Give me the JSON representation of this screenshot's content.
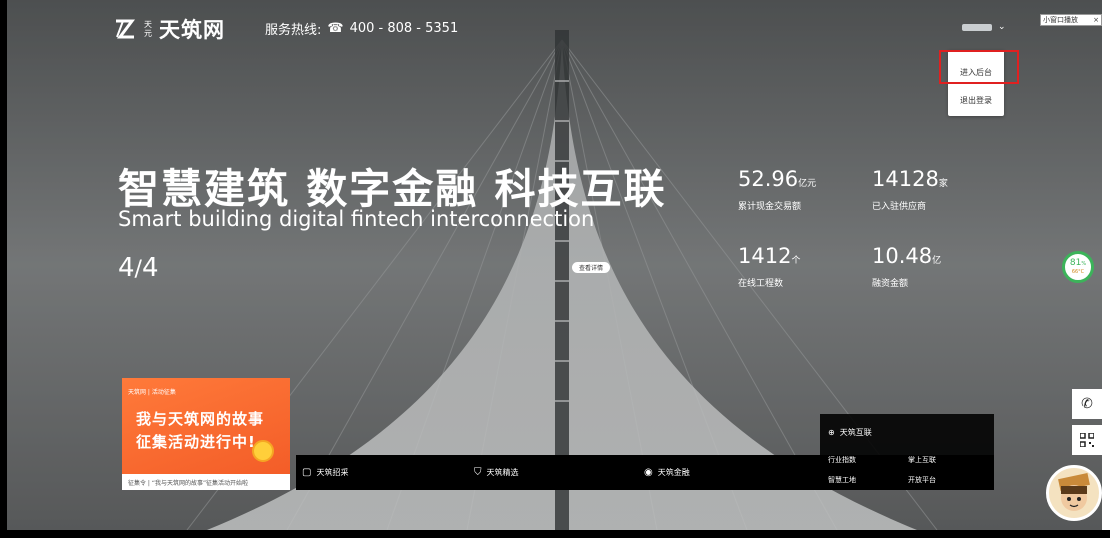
{
  "header": {
    "logo_small": "天元",
    "logo_text": "天筑网",
    "hotline_label": "服务热线:",
    "hotline_number": "400 - 808 - 5351"
  },
  "user_menu": {
    "items": [
      "进入后台",
      "退出登录"
    ]
  },
  "mini_window": {
    "label": "小窗口播放",
    "close": "×"
  },
  "hero": {
    "headline": "智慧建筑 数字金融 科技互联",
    "subline": "Smart building digital fintech interconnection",
    "pager_current": "4",
    "pager_total": "4",
    "detail_button": "查看详情"
  },
  "stats": [
    {
      "value": "52.96",
      "unit": "亿元",
      "label": "累计现金交易额"
    },
    {
      "value": "14128",
      "unit": "家",
      "label": "已入驻供应商"
    },
    {
      "value": "1412",
      "unit": "个",
      "label": "在线工程数"
    },
    {
      "value": "10.48",
      "unit": "亿",
      "label": "融资金额"
    }
  ],
  "performance": {
    "percent": "81",
    "percent_sign": "%",
    "temperature": "66°C",
    "color": "#3cb35a"
  },
  "promo": {
    "brand": "天筑网 | 活动征集",
    "title_line1": "我与天筑网的故事",
    "title_line2": "征集活动进行中!",
    "caption": "征集令 | “我与天筑网的故事”征集活动开始啦"
  },
  "nav": {
    "items": [
      {
        "label": "天筑招采",
        "icon": "document-icon"
      },
      {
        "label": "天筑精选",
        "icon": "cart-icon"
      },
      {
        "label": "天筑金融",
        "icon": "finance-icon"
      }
    ],
    "hulian": {
      "title": "天筑互联",
      "links": [
        "行业指数",
        "掌上互联",
        "智慧工地",
        "开放平台"
      ]
    }
  },
  "colors": {
    "accent_red": "#e02020",
    "promo_orange": "#f25a26"
  }
}
